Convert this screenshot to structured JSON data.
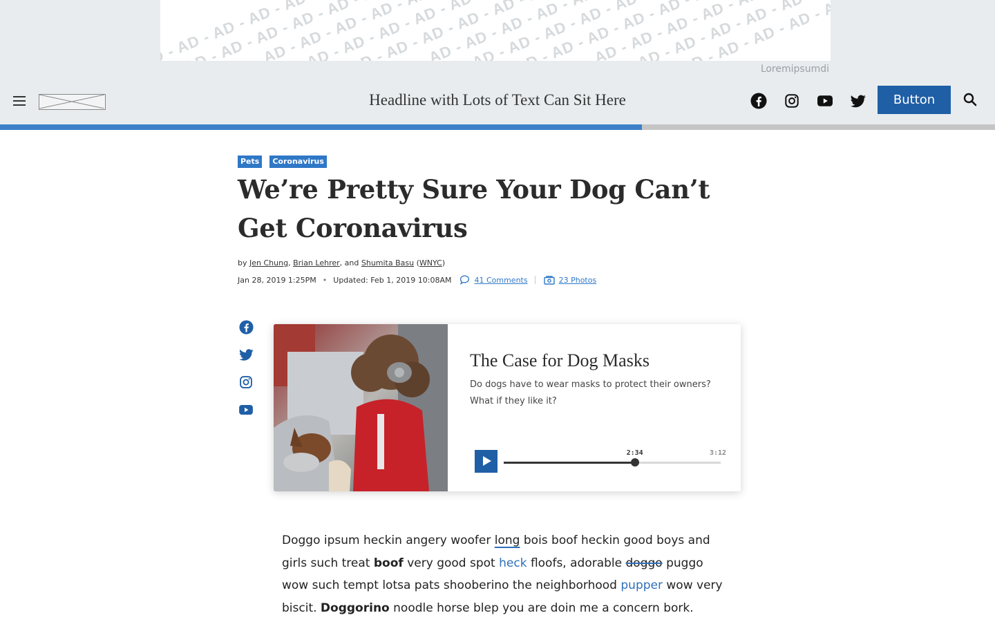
{
  "ad": {
    "pattern_text": "AD - AD - AD - AD - AD - AD - AD - AD - AD - AD - AD - AD - AD - AD - AD - AD - AD - AD - AD - AD - AD - AD",
    "caption": "Loremipsumdi"
  },
  "header": {
    "headline": "Headline with Lots of Text Can Sit Here",
    "button_label": "Button",
    "social_icons": [
      "facebook-icon",
      "instagram-icon",
      "youtube-icon",
      "twitter-icon"
    ]
  },
  "reading_progress": 0.645,
  "article": {
    "tags": [
      "Pets",
      "Coronavirus"
    ],
    "title": "We’re Pretty Sure Your Dog Can’t Get Coronavirus",
    "byline": {
      "prefix": "by",
      "authors": [
        "Jen Chung",
        "Brian Lehrer",
        "Shumita Basu"
      ],
      "and": "and",
      "source": "WNYC"
    },
    "meta": {
      "published": "Jan 28, 2019 1:25PM",
      "updated": "Updated: Feb 1, 2019 10:08AM",
      "comments": "41 Comments",
      "photos": "23 Photos"
    }
  },
  "media_card": {
    "title": "The Case for Dog Masks",
    "description": "Do dogs have to wear masks to protect their owners? What if they like it?",
    "current_time": "2:34",
    "total_time": "3:12",
    "progress": 0.604
  },
  "body": {
    "line1_a": "Doggo ipsum heckin angery woofer",
    "line1_b": "long",
    "line1_c": "bois boof heckin good boys and",
    "line2_a": "girls such treat",
    "line2_b": "boof",
    "line2_c": "very good spot",
    "line2_d": "heck",
    "line2_e": "floofs, adorable",
    "line2_f": "doggo",
    "line2_g": "puggo",
    "line3_a": "wow such tempt lotsa pats shooberino the neighborhood",
    "line3_b": "pupper",
    "line3_c": "wow",
    "line4_a": "very biscit.",
    "line4_b": "Doggorino",
    "line4_c": "noodle horse blep you are doin me a concern bork."
  },
  "colors": {
    "brand_blue": "#1f5fa6",
    "tag_blue": "#2f78c7",
    "progress_blue": "#3d80c8",
    "band_gray": "#e8ecef"
  }
}
